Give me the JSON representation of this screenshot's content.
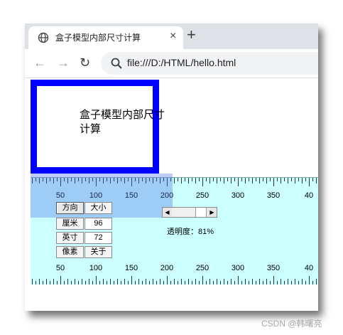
{
  "browser": {
    "tab_title": "盒子模型内部尺寸计算",
    "close_glyph": "×",
    "new_tab_glyph": "+",
    "back_glyph": "←",
    "forward_glyph": "→",
    "reload_glyph": "↻",
    "url": "file:///D:/HTML/hello.html"
  },
  "page": {
    "box_text": "盒子模型内部尺寸计算",
    "box_border_color": "#0000ff"
  },
  "ruler_tool": {
    "background": "#ccffff",
    "top_labels": [
      "50",
      "100",
      "150",
      "200",
      "250",
      "300",
      "350",
      "40"
    ],
    "bottom_labels": [
      "50",
      "100",
      "150",
      "200",
      "250",
      "300",
      "350",
      "40"
    ],
    "table": {
      "direction_label": "方向",
      "size_label": "大小",
      "rows": [
        {
          "unit": "厘米",
          "value": "96"
        },
        {
          "unit": "英寸",
          "value": "72"
        },
        {
          "unit": "像素",
          "value": "关于"
        }
      ]
    },
    "opacity_text": "透明度：81%",
    "opacity_value": 0.81
  },
  "watermark": "CSDN @韩曙亮"
}
